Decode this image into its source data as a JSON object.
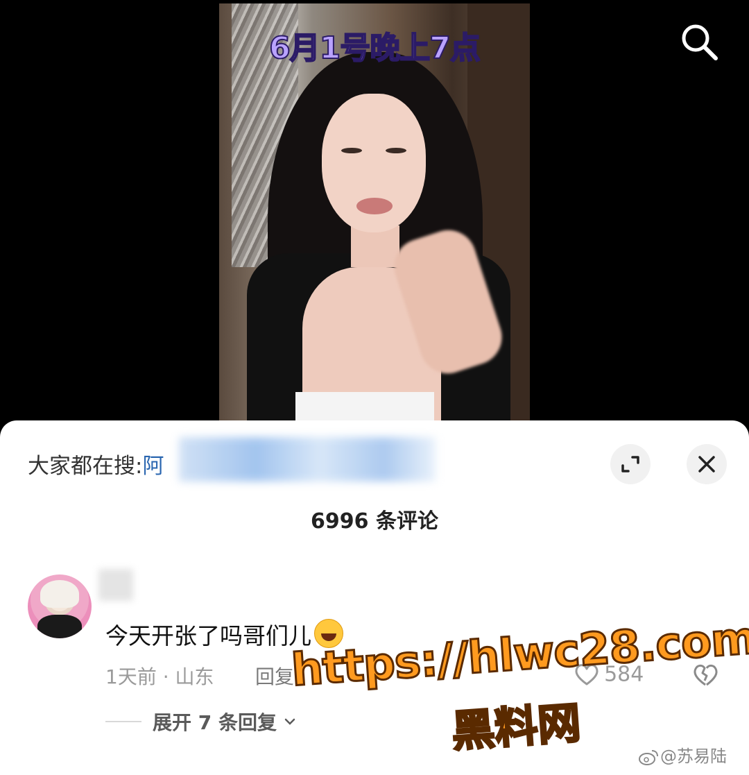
{
  "video": {
    "caption": "6月1号晚上7点"
  },
  "comments_panel": {
    "trending_label": "大家都在搜:",
    "trending_term": "阿",
    "comment_count": "6996 条评论",
    "comment": {
      "text": "今天开张了吗哥们儿",
      "emoji": "laughing-crying-emoji",
      "meta": "1天前 · 山东",
      "reply_label": "回复",
      "like_count": "584",
      "expand_label": "展开 7 条回复"
    }
  },
  "watermark": {
    "url": "https://hlwc28.com",
    "name": "黑料网"
  },
  "credit": {
    "handle": "@苏易陆"
  },
  "colors": {
    "caption_fill": "#b9a2ff",
    "trending_term": "#2a66b0",
    "watermark_fill": "#ff9a1f"
  }
}
